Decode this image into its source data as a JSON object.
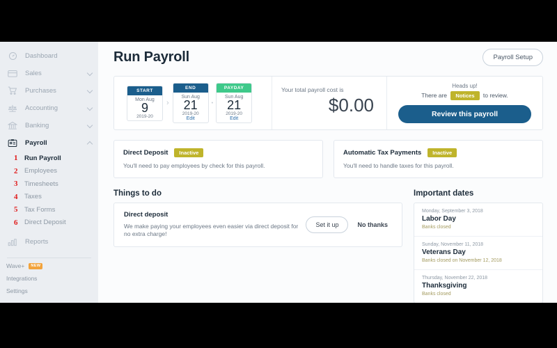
{
  "sidebar": {
    "items": [
      {
        "label": "Dashboard",
        "icon": "dashboard-gauge-icon",
        "expandable": false,
        "active": false
      },
      {
        "label": "Sales",
        "icon": "credit-card-icon",
        "expandable": true,
        "active": false
      },
      {
        "label": "Purchases",
        "icon": "shopping-cart-icon",
        "expandable": true,
        "active": false
      },
      {
        "label": "Accounting",
        "icon": "scales-icon",
        "expandable": true,
        "active": false
      },
      {
        "label": "Banking",
        "icon": "bank-icon",
        "expandable": true,
        "active": false
      },
      {
        "label": "Payroll",
        "icon": "id-badge-icon",
        "expandable": true,
        "active": true
      }
    ],
    "payroll_subitems": [
      {
        "number": "1",
        "label": "Run Payroll",
        "current": true
      },
      {
        "number": "2",
        "label": "Employees",
        "current": false
      },
      {
        "number": "3",
        "label": "Timesheets",
        "current": false
      },
      {
        "number": "4",
        "label": "Taxes",
        "current": false
      },
      {
        "number": "5",
        "label": "Tax Forms",
        "current": false
      },
      {
        "number": "6",
        "label": "Direct Deposit",
        "current": false
      }
    ],
    "reports": {
      "label": "Reports",
      "icon": "bar-chart-icon"
    },
    "footer_items": [
      {
        "label": "Wave+",
        "badge": "NEW"
      },
      {
        "label": "Integrations",
        "badge": ""
      },
      {
        "label": "Settings",
        "badge": ""
      }
    ]
  },
  "header": {
    "title": "Run Payroll",
    "setup_button": "Payroll Setup"
  },
  "summary": {
    "date_cards": [
      {
        "head": "START",
        "weekday_month": "Mon Aug",
        "day": "9",
        "year": "2019-20",
        "edit": ""
      },
      {
        "head": "END",
        "weekday_month": "Sun Aug",
        "day": "21",
        "year": "2019-20",
        "edit": "Edit"
      },
      {
        "head": "PAYDAY",
        "weekday_month": "Sun Aug",
        "day": "21",
        "year": "2019-20",
        "edit": "Edit"
      }
    ],
    "separator_chevron": "›",
    "separator_dot": "•",
    "cost_label": "Your total payroll cost is",
    "cost_value": "$0.00",
    "heads_up": "Heads up!",
    "notice_prefix": "There are",
    "notice_pill": "Notices",
    "notice_suffix": "to review.",
    "review_button": "Review this payroll"
  },
  "status_cards": [
    {
      "title": "Direct Deposit",
      "badge": "Inactive",
      "subtitle": "You'll need to pay employees by check for this payroll."
    },
    {
      "title": "Automatic Tax Payments",
      "badge": "Inactive",
      "subtitle": "You'll need to handle taxes for this payroll."
    }
  ],
  "things_to_do": {
    "section_title": "Things to do",
    "item_title": "Direct deposit",
    "item_body": "We make paying your employees even easier via direct deposit for no extra charge!",
    "primary_button": "Set it up",
    "secondary_button": "No thanks"
  },
  "important_dates": {
    "section_title": "Important dates",
    "items": [
      {
        "when": "Monday, September 3, 2018",
        "name": "Labor Day",
        "note": "Banks closed"
      },
      {
        "when": "Sunday, November 11, 2018",
        "name": "Veterans Day",
        "note": "Banks closed on November 12, 2018"
      },
      {
        "when": "Thursday, November 22, 2018",
        "name": "Thanksgiving",
        "note": "Banks closed"
      }
    ]
  },
  "colors": {
    "sidebar_bg": "#ebeef2",
    "brand_blue": "#1b5e8c",
    "payday_green": "#3ec98a",
    "badge_olive": "#bfb42b",
    "annotation_red": "#e01b1b",
    "new_badge_orange": "#f2a33c"
  }
}
